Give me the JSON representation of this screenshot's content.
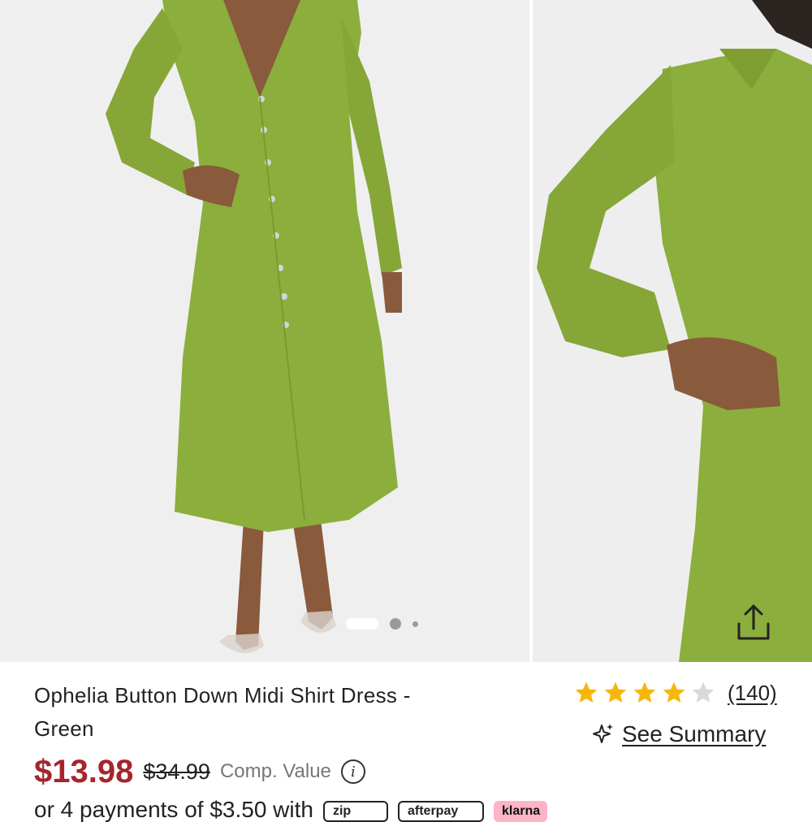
{
  "gallery": {
    "main_image_alt": "",
    "side_image_alt": "",
    "active_dot_index": 0,
    "dot_count": 3
  },
  "product": {
    "title_line1": "Ophelia Button Down Midi Shirt Dress -",
    "title_line2": "Green",
    "rating": 4,
    "rating_max": 5,
    "review_count": "(140)",
    "see_summary": "See Summary",
    "price": "$13.98",
    "original_price": "$34.99",
    "comp_value": "Comp. Value",
    "info_symbol": "i",
    "installments": "or 4 payments of $3.50 with",
    "pay_badges": [
      "zip",
      "afterpay",
      "klarna"
    ]
  },
  "colors": {
    "price": "#a4262c",
    "star_filled": "#f5b70a",
    "star_empty": "#d9d9d9",
    "dress_green": "#8cae3c"
  },
  "icons": {
    "share": "share-icon",
    "sparkle": "sparkle-icon",
    "info": "info-icon"
  }
}
